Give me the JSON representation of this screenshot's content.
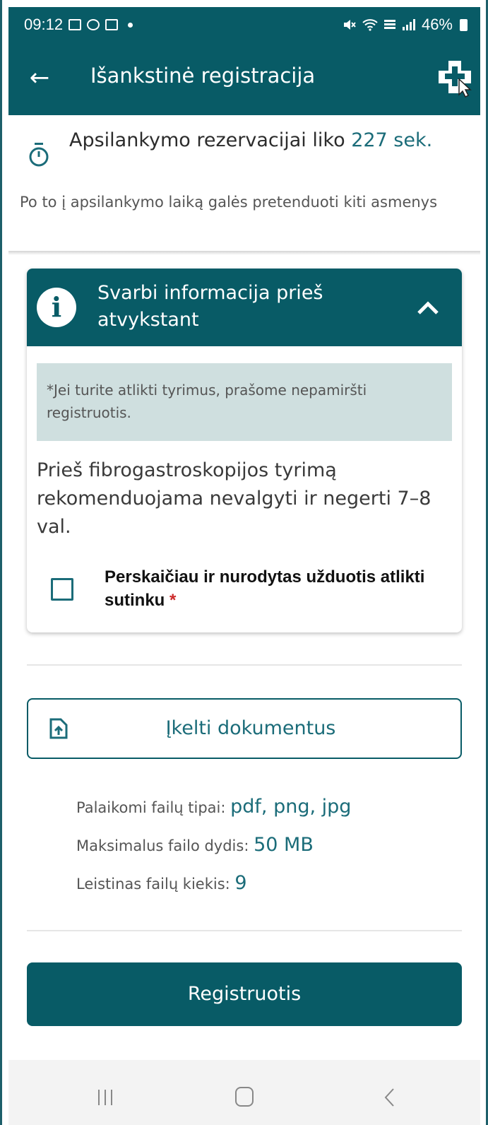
{
  "status_bar": {
    "time": "09:12",
    "battery": "46%",
    "icons": [
      "gallery-icon",
      "messenger-icon",
      "calendar-icon",
      "notification-dot-icon",
      "mute-icon",
      "wifi-icon",
      "lte-icon",
      "signal-icon",
      "battery-icon"
    ]
  },
  "app_bar": {
    "title": "Išankstinė registracija",
    "back_icon": "back-arrow-icon",
    "action_icon": "medical-plus-icon"
  },
  "countdown": {
    "prefix": "Apsilankymo rezervacijai liko ",
    "value": "227 sek.",
    "note": "Po to į apsilankymo laiką galės pretenduoti kiti asmenys"
  },
  "info_card": {
    "title": "Svarbi informacija prieš atvykstant",
    "note": "*Jei turite atlikti tyrimus, prašome nepamiršti registruotis.",
    "body": "Prieš fibrogastroskopijos tyrimą rekomenduojama nevalgyti ir negerti 7–8 val.",
    "checkbox_label": "Perskaičiau ir nurodytas užduotis atlikti sutinku",
    "required_mark": "*"
  },
  "upload": {
    "button_label": "Įkelti dokumentus",
    "file_types_label": "Palaikomi failų tipai: ",
    "file_types_value": "pdf, png, jpg",
    "max_size_label": "Maksimalus failo dydis: ",
    "max_size_value": "50 MB",
    "max_count_label": "Leistinas failų kiekis: ",
    "max_count_value": "9"
  },
  "register_button": "Registruotis",
  "colors": {
    "primary": "#085b66",
    "accent_text": "#1b6c79",
    "note_bg": "#cfdfdf",
    "required": "#cc2a2a"
  }
}
